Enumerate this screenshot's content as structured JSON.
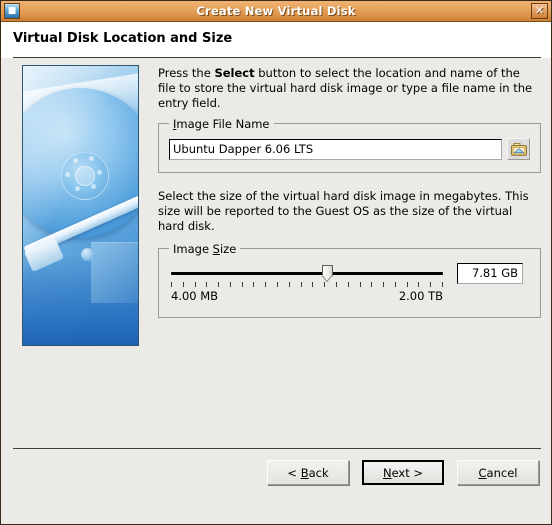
{
  "window": {
    "title": "Create New Virtual Disk",
    "title_icon": "virtualbox-disk-icon",
    "close_label": "✕"
  },
  "header": {
    "title": "Virtual Disk Location and Size"
  },
  "side_image": {
    "alt": "hard-disk-illustration"
  },
  "location_section": {
    "intro_before": "Press the ",
    "intro_bold": "Select",
    "intro_after": " button to select the location and name of the file to store the virtual hard disk image or type a file name in the entry field.",
    "group_label_pre": "",
    "group_label_mnemonic": "I",
    "group_label_post": "mage File Name",
    "file_name_value": "Ubuntu Dapper 6.06 LTS",
    "file_name_placeholder": "",
    "select_button_icon": "folder-open-icon"
  },
  "size_section": {
    "intro": "Select the size of the virtual hard disk image in megabytes. This size will be reported to the Guest OS as the size of the virtual hard disk.",
    "group_label_pre": "Image ",
    "group_label_mnemonic": "S",
    "group_label_post": "ize",
    "slider_min_label": "4.00 MB",
    "slider_max_label": "2.00 TB",
    "slider_value_label": "7.81 GB",
    "slider_position_percent": 58,
    "tick_count": 24
  },
  "footer": {
    "buttons": [
      {
        "name": "back-button",
        "pre": "< ",
        "mnemonic": "B",
        "post": "ack",
        "default": false
      },
      {
        "name": "next-button",
        "pre": "",
        "mnemonic": "N",
        "post": "ext >",
        "default": true
      },
      {
        "name": "cancel-button",
        "pre": "",
        "mnemonic": "C",
        "post": "ancel",
        "default": false
      }
    ]
  },
  "colors": {
    "titlebar_start": "#f0b273",
    "titlebar_end": "#cf8034",
    "window_bg": "#eceae6",
    "field_bg": "#ffffff",
    "image_blue": "#2a7ac6"
  }
}
